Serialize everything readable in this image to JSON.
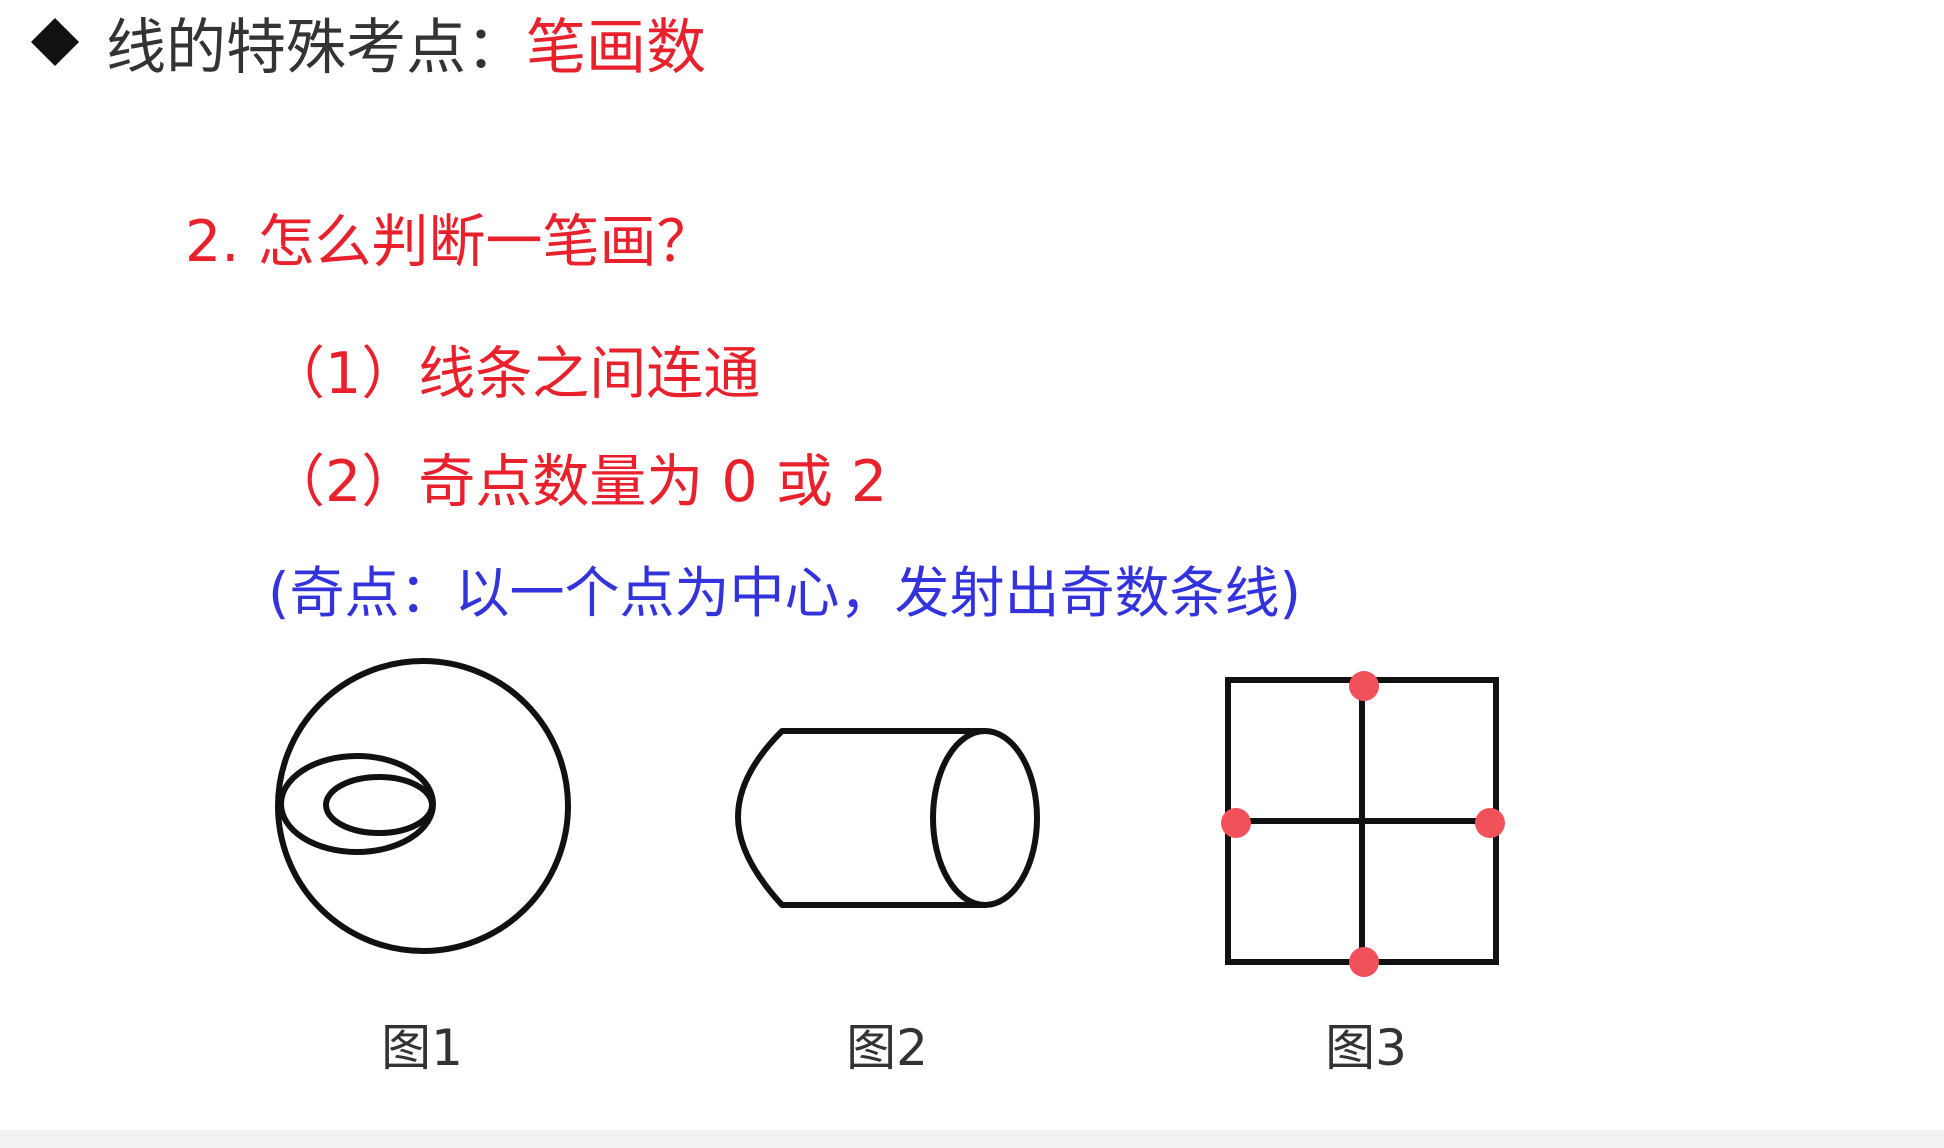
{
  "header": {
    "prefix": "线的特殊考点：",
    "highlight": "笔画数",
    "bullet_icon": "diamond-bullet-icon"
  },
  "question": {
    "title": "2. 怎么判断一笔画？"
  },
  "conditions": [
    {
      "text": "（1）线条之间连通"
    },
    {
      "text": "（2）奇点数量为 0 或 2"
    }
  ],
  "note": {
    "text": "(奇点：以一个点为中心，发射出奇数条线)"
  },
  "figures": [
    {
      "caption": "图1",
      "shape": "circle-with-two-inner-ellipses"
    },
    {
      "caption": "图2",
      "shape": "cylinder"
    },
    {
      "caption": "图3",
      "shape": "square-divided-into-four",
      "odd_point_count": 4
    }
  ],
  "colors": {
    "heading_red": "#e8212c",
    "note_blue": "#3333dd",
    "text_dark": "#333333",
    "odd_point_red": "#f0515a",
    "stroke": "#111111"
  }
}
